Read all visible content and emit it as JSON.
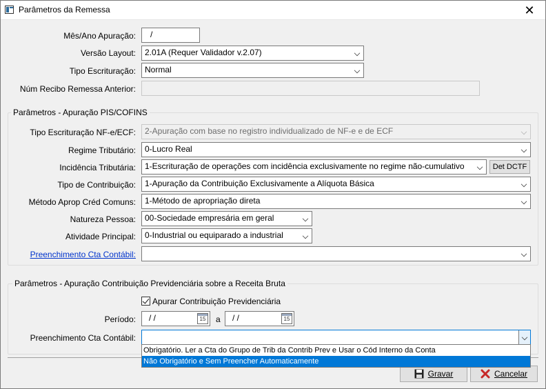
{
  "window": {
    "title": "Parâmetros da Remessa",
    "close_glyph": "✕"
  },
  "top": {
    "mes_ano_label": "Mês/Ano Apuração:",
    "mes_ano_value": "/",
    "versao_label": "Versão Layout:",
    "versao_value": "2.01A (Requer Validador v.2.07)",
    "tipo_escrit_label": "Tipo Escrituração:",
    "tipo_escrit_value": "Normal",
    "num_recibo_label": "Núm Recibo Remessa Anterior:",
    "num_recibo_value": ""
  },
  "pis": {
    "group_title": "Parâmetros - Apuração PIS/COFINS",
    "tipo_nfe_label": "Tipo Escrituração NF-e/ECF:",
    "tipo_nfe_value": "2-Apuração com base no registro individualizado de NF-e e de ECF",
    "regime_label": "Regime Tributário:",
    "regime_value": "0-Lucro Real",
    "incidencia_label": "Incidência Tributária:",
    "incidencia_value": "1-Escrituração de operações com incidência exclusivamente no regime não-cumulativo",
    "det_dctf_label": "Det DCTF",
    "tipo_contrib_label": "Tipo de Contribuição:",
    "tipo_contrib_value": "1-Apuração da Contribuição Exclusivamente a Alíquota Básica",
    "metodo_label": "Método Aprop Créd Comuns:",
    "metodo_value": "1-Método de apropriação direta",
    "natureza_label": "Natureza Pessoa:",
    "natureza_value": "00-Sociedade empresária em geral",
    "atividade_label": "Atividade Principal:",
    "atividade_value": "0-Industrial ou equiparado a industrial",
    "cta_contabil_label": "Preenchimento Cta Contábil:",
    "cta_contabil_value": ""
  },
  "prev": {
    "group_title": "Parâmetros - Apuração Contribuição Previdenciária sobre a Receita Bruta",
    "apurar_label": "Apurar Contribuição Previdenciária",
    "apurar_checked": true,
    "periodo_label": "Período:",
    "periodo_from": "/ /",
    "periodo_sep": "a",
    "periodo_to": "/ /",
    "cal_icon_text": "15",
    "cta_contabil_label": "Preenchimento Cta Contábil:",
    "cta_contabil_value": "",
    "options": [
      "Obrigatório. Ler a Cta do Grupo de Trib da Contrib Prev e Usar o Cód Interno da Conta",
      "Não Obrigatório e Sem Preencher Automaticamente"
    ],
    "selected_option_index": 1
  },
  "footer": {
    "gravar_label": "Gravar",
    "cancelar_label": "Cancelar"
  },
  "colors": {
    "accent": "#0078d7",
    "link": "#0033cc",
    "cancel_x": "#c62828"
  },
  "icons": {
    "window": "app-icon",
    "close": "close-icon",
    "calendar": "calendar-icon",
    "save": "floppy-disk-icon",
    "cancel": "red-x-icon"
  }
}
